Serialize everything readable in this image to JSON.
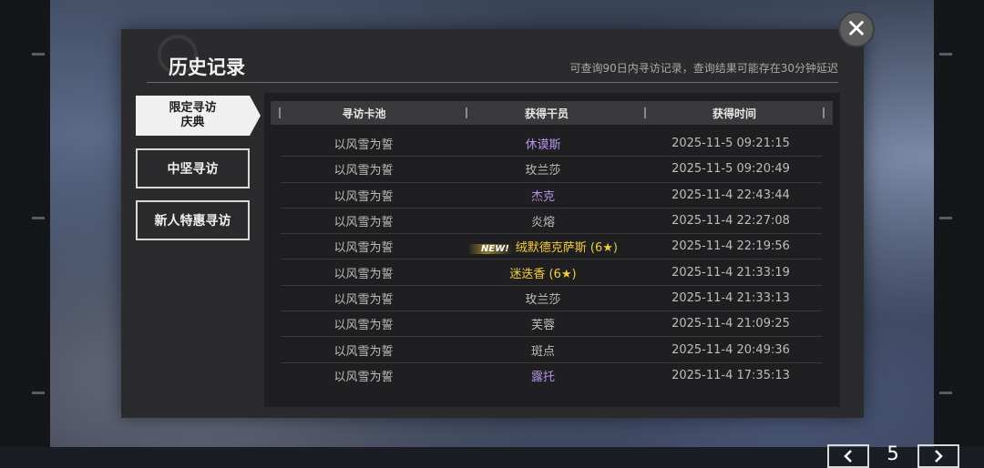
{
  "header": {
    "title": "历史记录",
    "note": "可查询90日内寻访记录，查询结果可能存在30分钟延迟",
    "close_icon": "close-icon"
  },
  "tabs": [
    {
      "label": "限定寻访\n庆典",
      "active": true
    },
    {
      "label": "中坚寻访",
      "active": false
    },
    {
      "label": "新人特惠寻访",
      "active": false
    }
  ],
  "table": {
    "columns": [
      "寻访卡池",
      "获得干员",
      "获得时间"
    ],
    "rows": [
      {
        "pool": "以风雪为誓",
        "operator": "休谟斯",
        "rarity": "purple",
        "new": "",
        "time": "2025-11-5 09:21:15"
      },
      {
        "pool": "以风雪为誓",
        "operator": "玫兰莎",
        "rarity": "plain",
        "new": "",
        "time": "2025-11-5 09:20:49"
      },
      {
        "pool": "以风雪为誓",
        "operator": "杰克",
        "rarity": "purple",
        "new": "",
        "time": "2025-11-4 22:43:44"
      },
      {
        "pool": "以风雪为誓",
        "operator": "炎熔",
        "rarity": "plain",
        "new": "",
        "time": "2025-11-4 22:27:08"
      },
      {
        "pool": "以风雪为誓",
        "operator": "绒默德克萨斯 (6★)",
        "rarity": "gold",
        "new": "NEW!",
        "time": "2025-11-4 22:19:56"
      },
      {
        "pool": "以风雪为誓",
        "operator": "迷迭香 (6★)",
        "rarity": "gold",
        "new": "",
        "time": "2025-11-4 21:33:19"
      },
      {
        "pool": "以风雪为誓",
        "operator": "玫兰莎",
        "rarity": "plain",
        "new": "",
        "time": "2025-11-4 21:33:13"
      },
      {
        "pool": "以风雪为誓",
        "operator": "芙蓉",
        "rarity": "plain",
        "new": "",
        "time": "2025-11-4 21:09:25"
      },
      {
        "pool": "以风雪为誓",
        "operator": "斑点",
        "rarity": "plain",
        "new": "",
        "time": "2025-11-4 20:49:36"
      },
      {
        "pool": "以风雪为誓",
        "operator": "露托",
        "rarity": "purple",
        "new": "",
        "time": "2025-11-4 17:35:13"
      }
    ]
  },
  "pager": {
    "current_page": "5",
    "prev_icon": "chevron-left-icon",
    "next_icon": "chevron-right-icon"
  },
  "colors": {
    "six_star": "#f3cc3a",
    "five_star": "#b493ea",
    "normal": "#bdbdbd"
  }
}
